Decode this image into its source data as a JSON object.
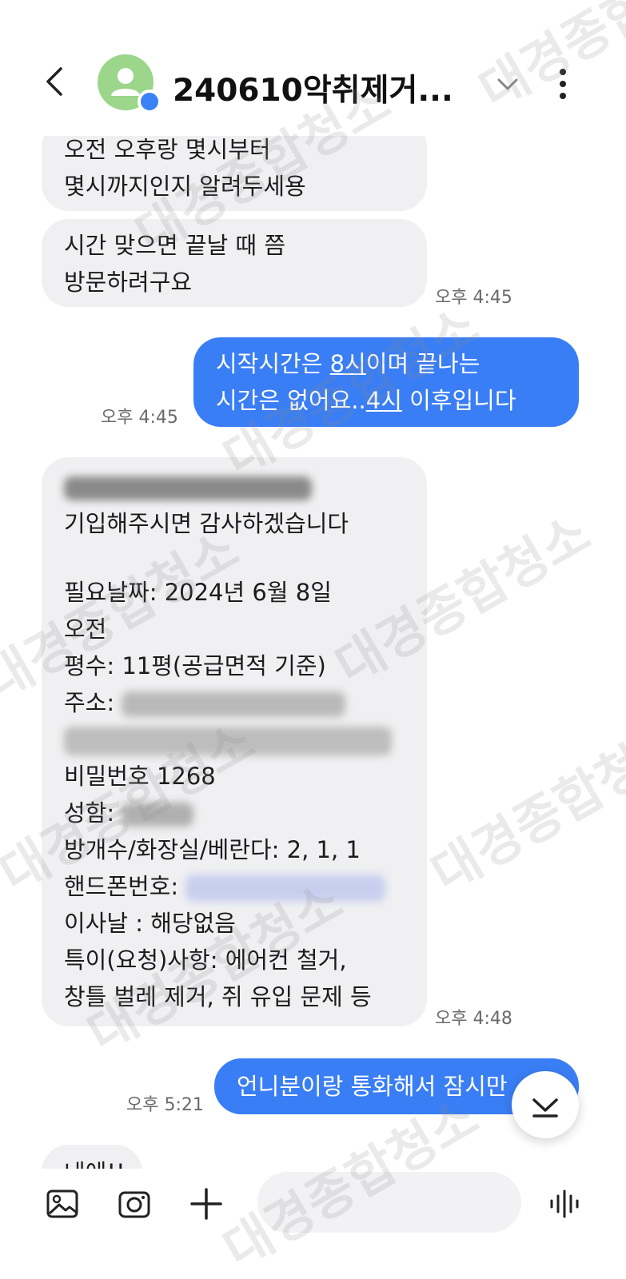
{
  "header": {
    "title": "240610악취제거...",
    "icons": {
      "back": "chevron-left-icon",
      "menu": "chevron-down-icon",
      "more": "kebab-icon"
    },
    "avatar_color": "#9bd68a",
    "badge_color": "#3b82f6"
  },
  "messages": {
    "m1": {
      "line1": "오전 오후랑 몇시부터",
      "line2": "몇시까지인지 알려두세용"
    },
    "m2": {
      "line1": "시간 맞으면 끝날 때 쯤",
      "line2": "방문하려구요",
      "time": "오후 4:45"
    },
    "m3": {
      "line1_a": "시작시간은 ",
      "line1_b": "8시",
      "line1_c": "이며 끝나는",
      "line2_a": "시간은 없어요..",
      "line2_b": "4시",
      "line2_c": " 이후입니다",
      "time": "오후 4:45"
    },
    "m4": {
      "l1": "기입해주시면 감사하겠습니다",
      "l2": "필요날짜:   2024년  6월   8일",
      "l3": "오전",
      "l4": "평수: 11평(공급면적 기준)",
      "l5": "주소:",
      "l6": "비밀번호 1268",
      "l7": "성함:",
      "l8": "방개수/화장실/베란다: 2, 1, 1",
      "l9": "핸드폰번호:",
      "l10": "이사날 : 해당없음",
      "l11": "특이(요청)사항: 에어컨 철거,",
      "l12": "창틀 벌레 제거, 쥐 유입 문제 등",
      "time": "오후 4:48"
    },
    "m5": {
      "text": "언니분이랑 통화해서 잠시만",
      "time": "오후 5:21"
    },
    "m6": {
      "text": "네에!!"
    }
  },
  "watermark": {
    "text": "대경종합청소"
  },
  "colors": {
    "outgoing": "#3a7ef5",
    "incoming": "#f0f0f2"
  }
}
